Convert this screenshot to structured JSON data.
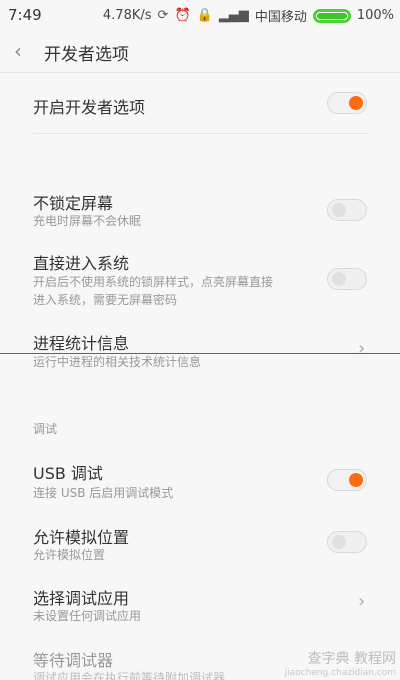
{
  "status": {
    "time": "7:49",
    "speed": "4.78K/s",
    "carrier": "中国移动",
    "battery": "100%"
  },
  "header": {
    "title": "开发者选项"
  },
  "items": {
    "dev_options": {
      "label": "开启开发者选项",
      "on": true
    },
    "stay_awake": {
      "label": "不锁定屏幕",
      "sub": "充电时屏幕不会休眠",
      "on": false
    },
    "direct_boot": {
      "label": "直接进入系统",
      "sub": "开启后不使用系统的锁屏样式，点亮屏幕直接进入系统，需要无屏幕密码",
      "on": false
    },
    "process_stats": {
      "label": "进程统计信息",
      "sub": "运行中进程的相关技术统计信息"
    },
    "usb_debug": {
      "label": "USB 调试",
      "sub": "连接 USB 后启用调试模式",
      "on": true
    },
    "mock_location": {
      "label": "允许模拟位置",
      "sub": "允许模拟位置",
      "on": false
    },
    "debug_app": {
      "label": "选择调试应用",
      "sub": "未设置任何调试应用"
    },
    "wait_debugger": {
      "label": "等待调试器",
      "sub": "调试应用会在执行前等待附加调试器"
    }
  },
  "sections": {
    "debug": "调试"
  },
  "watermark": {
    "main": "查字典 教程网",
    "url": "jiaocheng.chazidian.com"
  },
  "colors": {
    "accent": "#ff6a13",
    "annotation_line": "#d6322e"
  }
}
